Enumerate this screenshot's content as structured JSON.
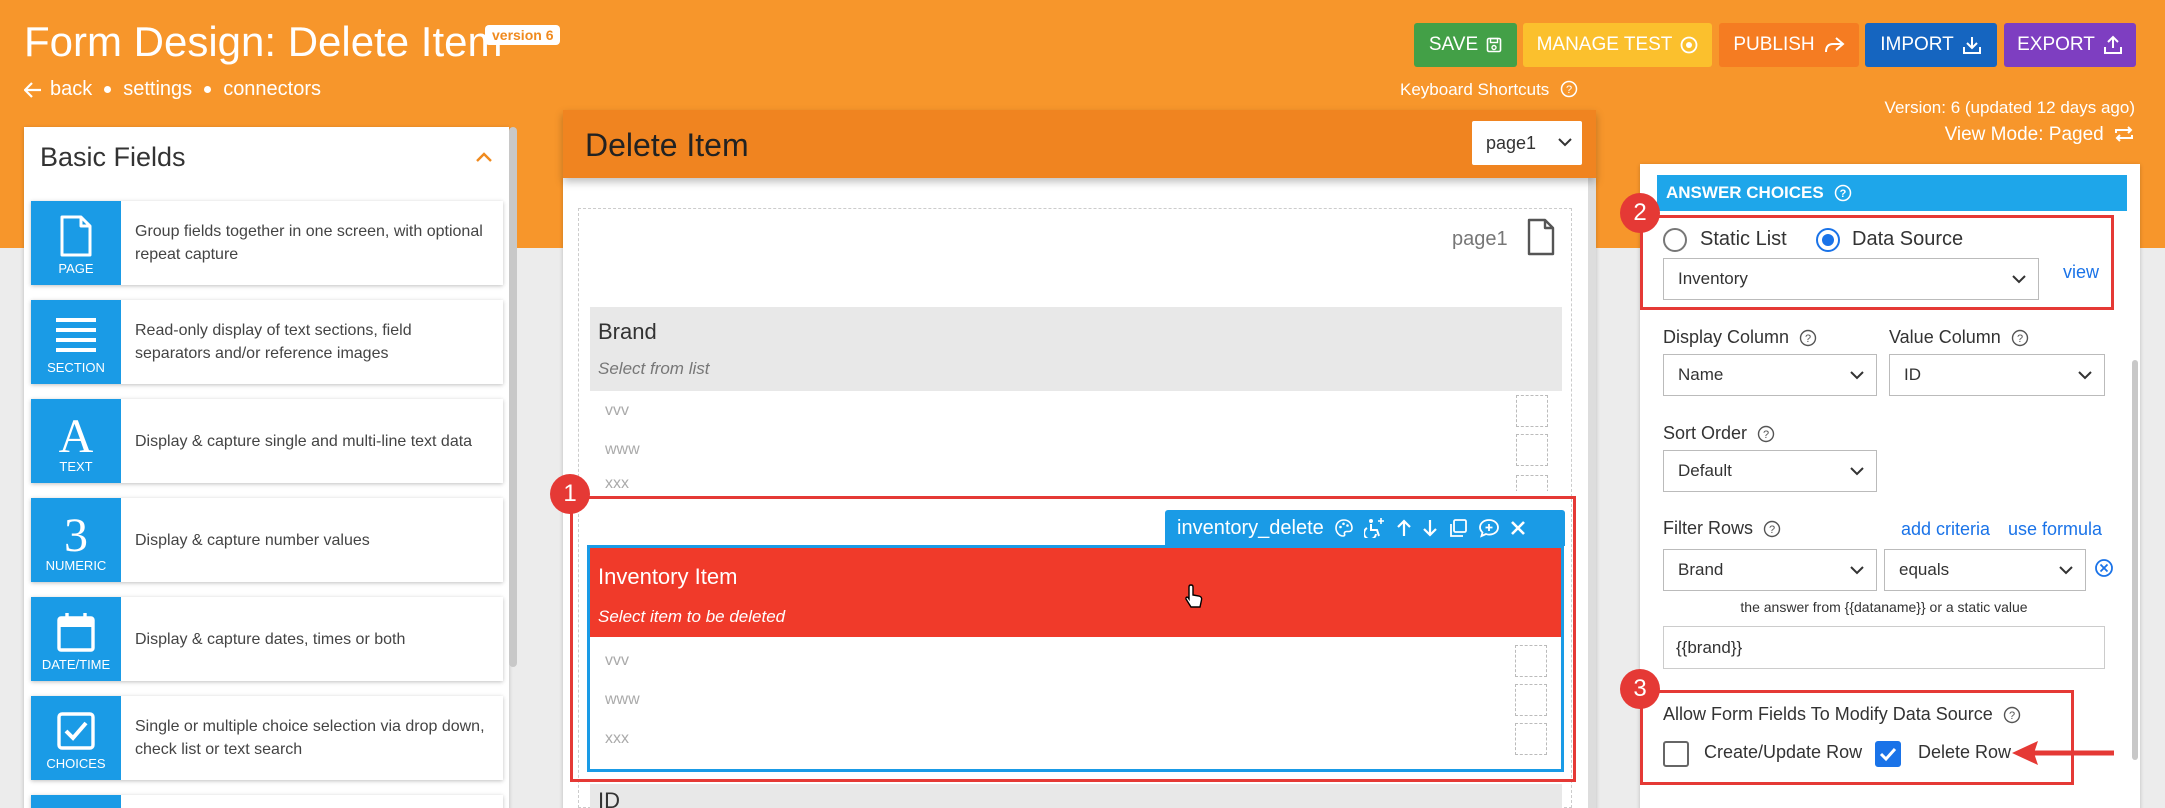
{
  "header": {
    "title": "Form Design: Delete Item",
    "version_badge": "version 6",
    "nav": {
      "back": "back",
      "settings": "settings",
      "connectors": "connectors"
    },
    "buttons": {
      "save": "SAVE",
      "manage_test": "MANAGE TEST",
      "publish": "PUBLISH",
      "import": "IMPORT",
      "export": "EXPORT"
    },
    "keyboard_shortcuts": "Keyboard Shortcuts",
    "version_info": "Version: 6 (updated 12 days ago)",
    "view_mode": "View Mode: Paged",
    "colors": {
      "bar": "#f7962b",
      "save": "#43a047",
      "manage_test": "#fbc02d",
      "publish": "#f57c22",
      "import": "#1565c0",
      "export": "#7e3ec1"
    }
  },
  "left_panel": {
    "title": "Basic Fields",
    "items": [
      {
        "label": "PAGE",
        "icon": "page-icon",
        "desc": "Group fields together in one screen, with optional repeat capture"
      },
      {
        "label": "SECTION",
        "icon": "section-icon",
        "desc": "Read-only display of text sections, field separators and/or reference images"
      },
      {
        "label": "TEXT",
        "icon": "text-icon",
        "desc": "Display & capture single and multi-line text data"
      },
      {
        "label": "NUMERIC",
        "icon": "numeric-icon",
        "desc": "Display & capture number values"
      },
      {
        "label": "DATE/TIME",
        "icon": "calendar-icon",
        "desc": "Display & capture dates, times or both"
      },
      {
        "label": "CHOICES",
        "icon": "checkbox-icon",
        "desc": "Single or multiple choice selection via drop down, check list or text search"
      }
    ]
  },
  "form": {
    "title": "Delete Item",
    "page_select": "page1",
    "page_label": "page1",
    "brand": {
      "title": "Brand",
      "hint": "Select from list",
      "options": [
        "vvv",
        "www",
        "xxx"
      ]
    },
    "inventory": {
      "tag": "inventory_delete",
      "title": "Inventory Item",
      "hint": "Select item to be deleted",
      "options": [
        "vvv",
        "www",
        "xxx"
      ],
      "color": "#f03a2a"
    },
    "next_field": "ID"
  },
  "right_panel": {
    "section_title": "ANSWER CHOICES",
    "static_list": "Static List",
    "data_source": "Data Source",
    "data_source_selected": true,
    "data_source_value": "Inventory",
    "view_link": "view",
    "display_column_label": "Display Column",
    "display_column_value": "Name",
    "value_column_label": "Value Column",
    "value_column_value": "ID",
    "sort_order_label": "Sort Order",
    "sort_order_value": "Default",
    "filter_rows_label": "Filter Rows",
    "add_criteria": "add criteria",
    "use_formula": "use formula",
    "filter_field": "Brand",
    "filter_op": "equals",
    "filter_note": "the answer from {{dataname}} or a static value",
    "filter_value": "{{brand}}",
    "modify_label": "Allow Form Fields To Modify Data Source",
    "create_update_row": "Create/Update Row",
    "create_update_checked": false,
    "delete_row": "Delete Row",
    "delete_row_checked": true
  },
  "annotations": [
    "1",
    "2",
    "3"
  ]
}
